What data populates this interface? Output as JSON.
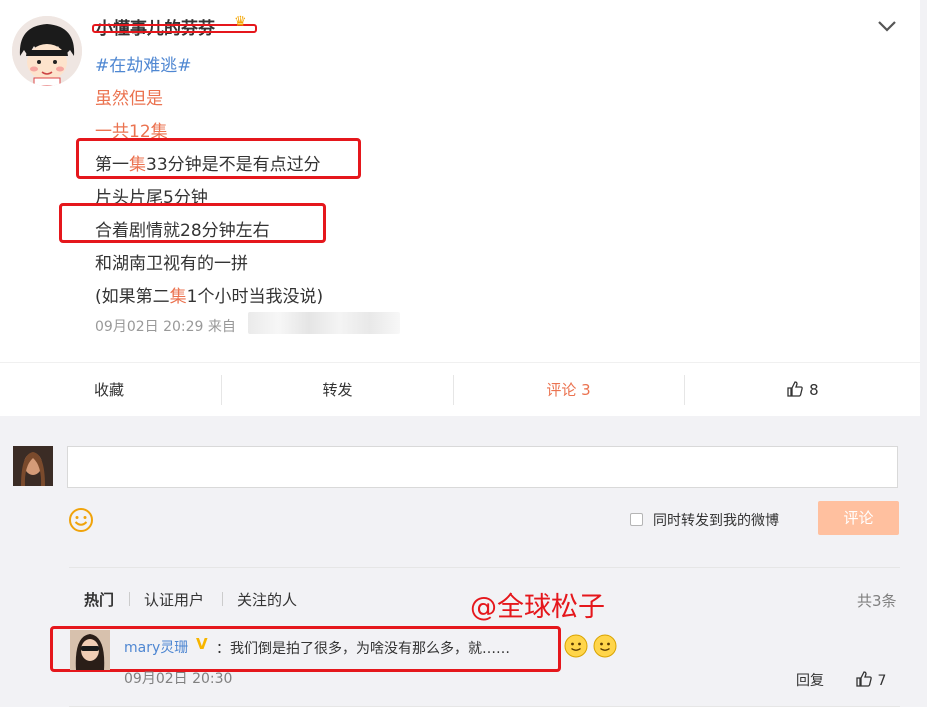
{
  "post": {
    "username": "小懂事儿的芬芬",
    "lines": [
      {
        "parts": [
          {
            "text": "#在劫难逃#",
            "style": "topic"
          }
        ]
      },
      {
        "parts": [
          {
            "text": "虽然但是",
            "style": "red"
          }
        ]
      },
      {
        "parts": [
          {
            "text": "一共12集",
            "style": "red"
          }
        ]
      },
      {
        "parts": [
          {
            "text": "第一",
            "style": ""
          },
          {
            "text": "集",
            "style": "red"
          },
          {
            "text": "33分钟是不是有点过分",
            "style": ""
          }
        ]
      },
      {
        "parts": [
          {
            "text": "片头片尾5分钟",
            "style": ""
          }
        ]
      },
      {
        "parts": [
          {
            "text": "合着剧情就28分钟左右",
            "style": ""
          }
        ]
      },
      {
        "parts": [
          {
            "text": "和湖南卫视有的一拼",
            "style": ""
          }
        ]
      },
      {
        "parts": [
          {
            "text": "(如果第二",
            "style": ""
          },
          {
            "text": "集",
            "style": "red"
          },
          {
            "text": "1个小时当我没说)",
            "style": ""
          }
        ]
      }
    ],
    "time": "09月02日 20:29",
    "source_prefix": "来自"
  },
  "actions": {
    "favorite": "收藏",
    "repost": "转发",
    "comment": "评论 3",
    "like_count": "8"
  },
  "composer": {
    "placeholder": "",
    "repost_label": "同时转发到我的微博",
    "submit_label": "评论"
  },
  "comments_header": {
    "tabs": [
      "热门",
      "认证用户",
      "关注的人"
    ],
    "total": "共3条"
  },
  "watermark": "@全球松子",
  "comments": [
    {
      "user": "mary灵珊",
      "separator": "：",
      "text": "我们倒是拍了很多，为啥没有那么多，就……",
      "time": "09月02日 20:30",
      "reply_label": "回复",
      "likes": "7"
    }
  ],
  "colors": {
    "accent_orange": "#eb7350",
    "link_blue": "#4f87d2",
    "annotation_red": "#e5171c",
    "button_disabled": "#ffc09f"
  },
  "icons": [
    "chevron-down-icon",
    "thumbs-up-icon",
    "smile-emoji-icon",
    "verified-badge-icon",
    "crown-badge-icon"
  ]
}
